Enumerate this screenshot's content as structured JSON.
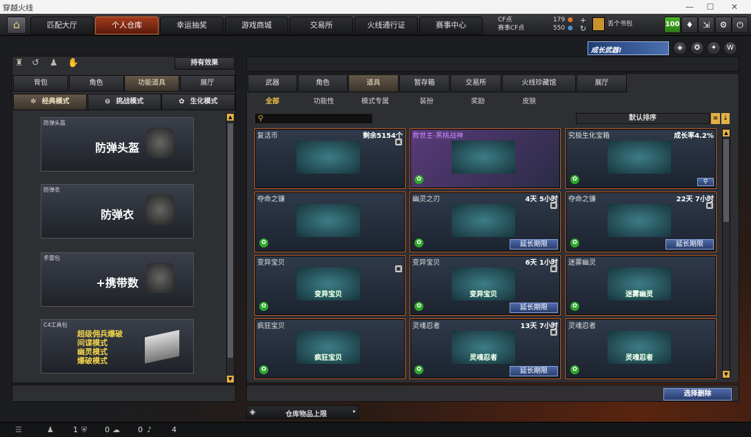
{
  "window": {
    "title": "穿越火线"
  },
  "nav": {
    "tabs": [
      "匹配大厅",
      "个人仓库",
      "幸运抽奖",
      "游戏商城",
      "交易所",
      "火线通行证",
      "赛事中心"
    ],
    "active": "个人仓库",
    "cf_label": "CF点",
    "cf_value": "179",
    "match_cf_label": "赛事CF点",
    "match_cf_value": "550",
    "bag_label": "丢个书包",
    "level": "100"
  },
  "banner": {
    "text": "成长武器!"
  },
  "left": {
    "effect_button": "持有效果",
    "tabs": [
      "背包",
      "角色",
      "功能道具",
      "展厅"
    ],
    "active_tab": "功能道具",
    "modes": [
      "经典模式",
      "挑战模式",
      "生化模式"
    ],
    "active_mode": "经典模式",
    "items": [
      {
        "header": "防弹头盔",
        "title": "防弹头盔"
      },
      {
        "header": "防弹衣",
        "title": "防弹衣"
      },
      {
        "header": "手雷包",
        "title": "+携带数"
      },
      {
        "header": "C4工具包",
        "lines": [
          "超级佣兵爆破",
          "间谍模式",
          "幽灵模式",
          "爆破模式"
        ]
      }
    ]
  },
  "right": {
    "tabs": [
      "武器",
      "角色",
      "道具",
      "暂存箱",
      "交易所",
      "火线珍藏馆",
      "展厅"
    ],
    "active_tab": "道具",
    "subtabs": [
      "全部",
      "功能性",
      "模式专属",
      "装扮",
      "奖励",
      "皮肤"
    ],
    "active_subtab": "全部",
    "search_placeholder": "",
    "sort_label": "默认排序",
    "extend_label": "延长期限",
    "items": [
      {
        "name": "复活币",
        "info": "剩余5154个",
        "art": "",
        "lock": true,
        "action": ""
      },
      {
        "name": "救世主-黑桃战神",
        "info": "",
        "art": "",
        "lock": false,
        "action": "",
        "purple": true
      },
      {
        "name": "究极生化宝箱",
        "info": "成长率4.2%",
        "art": "",
        "lock": false,
        "action": "search"
      },
      {
        "name": "夺命之镰",
        "info": "",
        "art": "",
        "lock": false,
        "action": ""
      },
      {
        "name": "幽灵之刃",
        "info": "4天 5小时",
        "art": "",
        "lock": true,
        "action": "extend"
      },
      {
        "name": "夺命之镰",
        "info": "22天 7小时",
        "art": "",
        "lock": true,
        "action": "extend"
      },
      {
        "name": "变异宝贝",
        "info": "",
        "art": "变异宝贝",
        "lock": true,
        "action": ""
      },
      {
        "name": "变异宝贝",
        "info": "6天 1小时",
        "art": "变异宝贝",
        "lock": true,
        "action": "extend"
      },
      {
        "name": "迷雾幽灵",
        "info": "",
        "art": "迷雾幽灵",
        "lock": false,
        "action": ""
      },
      {
        "name": "疯狂宝贝",
        "info": "",
        "art": "疯狂宝贝",
        "lock": false,
        "action": ""
      },
      {
        "name": "灵魂忍者",
        "info": "13天 7小时",
        "art": "灵魂忍者",
        "lock": true,
        "action": "extend"
      },
      {
        "name": "灵魂忍者",
        "info": "",
        "art": "灵魂忍者",
        "lock": false,
        "action": ""
      }
    ],
    "batch_delete": "选择删除",
    "capacity_label": "仓库物品上限"
  },
  "status": {
    "count1": "1",
    "count2": "0",
    "count3": "0",
    "count4": "4"
  }
}
